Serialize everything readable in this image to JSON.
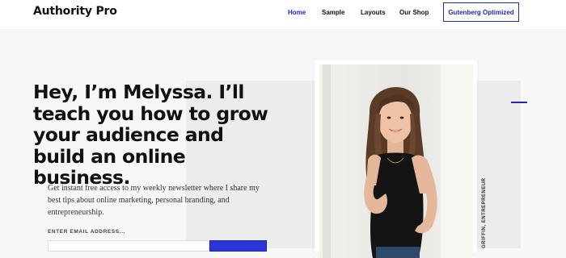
{
  "brand": {
    "logo": "Authority Pro"
  },
  "nav": {
    "items": [
      {
        "label": "Home",
        "active": true
      },
      {
        "label": "Sample"
      },
      {
        "label": "Layouts"
      },
      {
        "label": "Our Shop"
      }
    ],
    "cta_label": "Gutenberg Optimized"
  },
  "hero": {
    "headline": "Hey, I’m Melyssa. I’ll teach you how to grow your audience and build an online business.",
    "subtext": "Get instant free access to my weekly newsletter where I share my best tips about online marketing, personal branding, and entrepreneurship.",
    "email_label": "ENTER EMAIL ADDRESS...",
    "email_value": "",
    "submit_label": "",
    "photo_caption": "GRIFFIN, ENTREPRENEUR"
  },
  "colors": {
    "accent": "#1a2bbb",
    "button": "#2b35d6",
    "page_background": "#f7f7f7",
    "band": "#ececec"
  }
}
